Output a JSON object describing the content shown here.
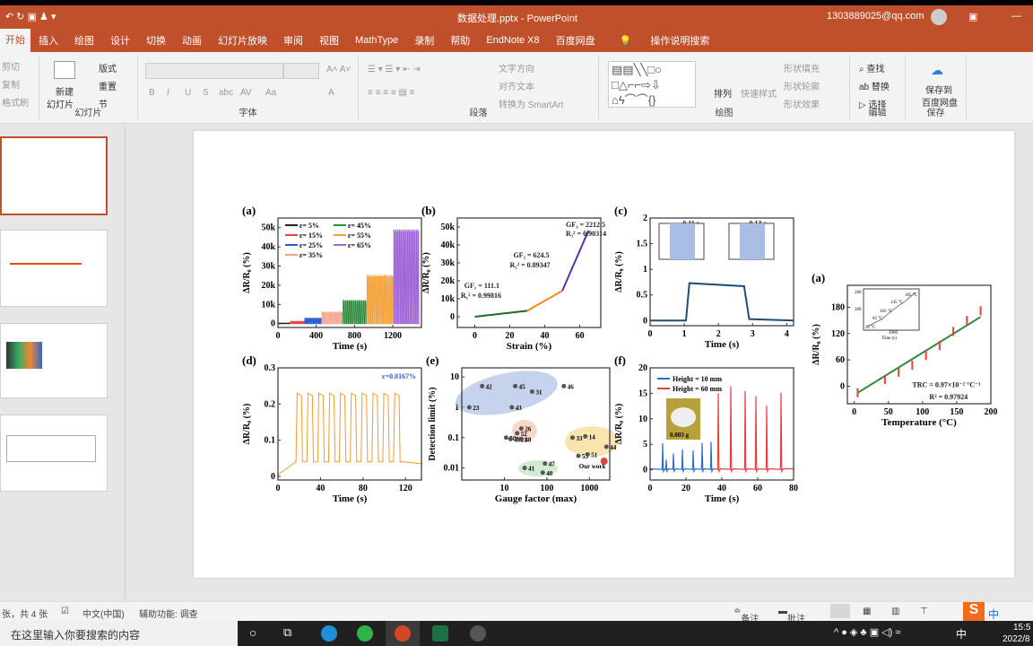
{
  "titlebar": {
    "filename": "数据处理.pptx - PowerPoint",
    "account": "1303889025@qq.com"
  },
  "tabs": [
    "开始",
    "插入",
    "绘图",
    "设计",
    "切换",
    "动画",
    "幻灯片放映",
    "审阅",
    "视图",
    "MathType",
    "录制",
    "帮助",
    "EndNote X8",
    "百度网盘",
    "操作说明搜索"
  ],
  "ribbon": {
    "clipboard": {
      "cut": "剪切",
      "copy": "复制",
      "format_painter": "格式刷"
    },
    "slides": {
      "new_slide": "新建",
      "new_slide2": "幻灯片",
      "layout": "版式",
      "reset": "重置",
      "section": "节",
      "label": "幻灯片"
    },
    "font": {
      "label": "字体",
      "bold": "B",
      "italic": "I",
      "underline": "U",
      "shadow": "S",
      "strike": "abc",
      "spacing": "AV",
      "case": "Aa",
      "color": "A"
    },
    "paragraph": {
      "label": "段落",
      "text_direction": "文字方向",
      "align_text": "对齐文本",
      "smartart": "转换为 SmartArt"
    },
    "drawing": {
      "label": "绘图",
      "arrange": "排列",
      "quick_styles": "快速样式",
      "fill": "形状填充",
      "outline": "形状轮廓",
      "effects": "形状效果"
    },
    "editing": {
      "label": "编辑",
      "find": "查找",
      "replace": "替换",
      "select": "选择"
    },
    "save": {
      "label": "保存",
      "save_to": "保存到",
      "baidu": "百度网盘"
    }
  },
  "status": {
    "slide_count": "张，共 4 张",
    "language": "中文(中国)",
    "accessibility": "辅助功能: 调查",
    "notes": "备注",
    "comments": "批注"
  },
  "taskbar": {
    "search_placeholder": "在这里输入你要搜索的内容",
    "time": "15:5",
    "date": "2022/8",
    "ime": "中"
  },
  "chart_data": [
    {
      "panel": "(a)",
      "type": "line",
      "xlim": [
        0,
        1500
      ],
      "ylim": [
        -2000,
        55000
      ],
      "xlabel": "Time (s)",
      "ylabel": "ΔR/R₀ (%)",
      "xticks": [
        [
          0,
          "0"
        ],
        [
          400,
          "400"
        ],
        [
          800,
          "800"
        ],
        [
          1200,
          "1200"
        ]
      ],
      "yticks": [
        [
          0,
          "0"
        ],
        [
          10000,
          "10k"
        ],
        [
          20000,
          "20k"
        ],
        [
          30000,
          "30k"
        ],
        [
          40000,
          "40k"
        ],
        [
          50000,
          "50k"
        ]
      ],
      "waves": [
        {
          "name": "ε= 5%",
          "color": "#222222",
          "t": [
            0,
            130
          ],
          "peak": 300,
          "cycles": 8
        },
        {
          "name": "ε= 15%",
          "color": "#e8413c",
          "t": [
            130,
            280
          ],
          "peak": 1200,
          "cycles": 8
        },
        {
          "name": "ε= 25%",
          "color": "#2a5bd7",
          "t": [
            280,
            460
          ],
          "peak": 2800,
          "cycles": 10
        },
        {
          "name": "ε= 35%",
          "color": "#f4a088",
          "t": [
            460,
            680
          ],
          "peak": 6000,
          "cycles": 10
        },
        {
          "name": "ε= 45%",
          "color": "#2e8b3e",
          "t": [
            680,
            930
          ],
          "peak": 12000,
          "cycles": 12
        },
        {
          "name": "ε= 55%",
          "color": "#f2a23a",
          "t": [
            930,
            1210
          ],
          "peak": 25000,
          "cycles": 14
        },
        {
          "name": "ε= 65%",
          "color": "#a066d8",
          "t": [
            1210,
            1480
          ],
          "peak": 49000,
          "cycles": 14
        }
      ]
    },
    {
      "panel": "(b)",
      "type": "line",
      "xlim": [
        -10,
        72
      ],
      "ylim": [
        -6000,
        55000
      ],
      "xlabel": "Strain (%)",
      "ylabel": "ΔR/R₀ (%)",
      "xticks": [
        [
          0,
          "0"
        ],
        [
          20,
          "20"
        ],
        [
          40,
          "40"
        ],
        [
          60,
          "60"
        ]
      ],
      "yticks": [
        [
          0,
          "0"
        ],
        [
          10000,
          "10k"
        ],
        [
          20000,
          "20k"
        ],
        [
          30000,
          "30k"
        ],
        [
          40000,
          "40k"
        ],
        [
          50000,
          "50k"
        ]
      ],
      "series": [
        {
          "name": "GF1",
          "color": "#1e6b2a",
          "points": [
            [
              0,
              0
            ],
            [
              30,
              3300
            ]
          ]
        },
        {
          "name": "GF2",
          "color": "#f08a1c",
          "points": [
            [
              30,
              3300
            ],
            [
              50,
              14500
            ]
          ]
        },
        {
          "name": "GF3",
          "color": "#5b2fa8",
          "points": [
            [
              50,
              14500
            ],
            [
              65,
              48000
            ]
          ]
        }
      ],
      "annotations": [
        {
          "text": "GF₃ = 2212.5",
          "x": 52,
          "y": 50000
        },
        {
          "text": "R₃² = 0.90314",
          "x": 52,
          "y": 45000
        },
        {
          "text": "GF₂ = 624.5",
          "x": 22,
          "y": 33000
        },
        {
          "text": "R₂² = 0.89347",
          "x": 20,
          "y": 27500
        },
        {
          "text": "GF₁ = 111.1",
          "x": -6,
          "y": 16000
        },
        {
          "text": "R₁² = 0.99816",
          "x": -8,
          "y": 10500
        }
      ]
    },
    {
      "panel": "(c)",
      "type": "line",
      "xlim": [
        0,
        4.2
      ],
      "ylim": [
        -0.1,
        2
      ],
      "xlabel": "Time (s)",
      "ylabel": "ΔR/R₀ (%)",
      "xticks": [
        [
          0,
          "0"
        ],
        [
          1,
          "1"
        ],
        [
          2,
          "2"
        ],
        [
          3,
          "3"
        ],
        [
          4,
          "4"
        ]
      ],
      "yticks": [
        [
          0,
          "0"
        ],
        [
          0.5,
          "0.5"
        ],
        [
          1,
          "1"
        ],
        [
          1.5,
          "1.5"
        ],
        [
          2,
          "2"
        ]
      ],
      "series": [
        {
          "name": "response",
          "color": "#1f4e79",
          "points": [
            [
              0,
              0
            ],
            [
              1.05,
              0
            ],
            [
              1.15,
              0.73
            ],
            [
              2.75,
              0.67
            ],
            [
              2.9,
              0.03
            ],
            [
              4.2,
              0
            ]
          ]
        }
      ],
      "annotations": [
        {
          "text": "0.11 s",
          "x": 0.95,
          "y": 1.85
        },
        {
          "text": "0.13 s",
          "x": 2.9,
          "y": 1.85
        }
      ]
    },
    {
      "panel": "(a)",
      "type": "line",
      "xlim": [
        -10,
        200
      ],
      "ylim": [
        -40,
        230
      ],
      "xlabel": "Temperature (°C)",
      "ylabel": "ΔR/R₀ (%)",
      "xticks": [
        [
          0,
          "0"
        ],
        [
          50,
          "50"
        ],
        [
          100,
          "100"
        ],
        [
          150,
          "150"
        ],
        [
          200,
          "200"
        ]
      ],
      "yticks": [
        [
          0,
          "0"
        ],
        [
          60,
          "60"
        ],
        [
          120,
          "120"
        ],
        [
          180,
          "180"
        ]
      ],
      "series": [
        {
          "name": "fit",
          "color": "#2e8b3e",
          "points": [
            [
              5,
              -15
            ],
            [
              185,
              158
            ]
          ]
        }
      ],
      "errpoints": {
        "color": "#e8413c",
        "points": [
          [
            5,
            -15
          ],
          [
            45,
            15
          ],
          [
            65,
            32
          ],
          [
            85,
            48
          ],
          [
            105,
            70
          ],
          [
            125,
            93
          ],
          [
            145,
            125
          ],
          [
            165,
            150
          ],
          [
            185,
            172
          ]
        ]
      },
      "annotations": [
        {
          "text": "TRC = 0.97×10⁻² °C⁻¹",
          "x": 85,
          "y": -2
        },
        {
          "text": "R² = 0.97924",
          "x": 110,
          "y": -30
        }
      ],
      "inset_labels": [
        "185 °C",
        "145 °C",
        "105 °C",
        "65 °C",
        "25 °C",
        "Time (s)",
        "2000",
        "200",
        "100"
      ]
    },
    {
      "panel": "(d)",
      "type": "line",
      "xlim": [
        0,
        135
      ],
      "ylim": [
        -0.01,
        0.3
      ],
      "xlabel": "Time (s)",
      "ylabel": "ΔR/R₀ (%)",
      "xticks": [
        [
          0,
          "0"
        ],
        [
          40,
          "40"
        ],
        [
          80,
          "80"
        ],
        [
          120,
          "120"
        ]
      ],
      "yticks": [
        [
          0,
          "0"
        ],
        [
          0.1,
          "0.1"
        ],
        [
          0.2,
          "0.2"
        ],
        [
          0.3,
          "0.3"
        ]
      ],
      "waves": [
        {
          "name": "ε=0.0167%",
          "color": "#f29a2e",
          "t": [
            17,
            119
          ],
          "peak": 0.23,
          "base": 0.04,
          "cycles": 10
        }
      ],
      "annotations": [
        {
          "text": "ε=0.0167%",
          "x": 98,
          "y": 0.27
        }
      ]
    },
    {
      "panel": "(e)",
      "type": "scatter",
      "xlog": true,
      "ylog": true,
      "xlim": [
        1,
        3000
      ],
      "ylim": [
        0.004,
        20
      ],
      "xlabel": "Gauge factor (max)",
      "ylabel": "Detection limit (%)",
      "xticks": [
        [
          10,
          "10"
        ],
        [
          100,
          "100"
        ],
        [
          1000,
          "1000"
        ]
      ],
      "yticks": [
        [
          0.01,
          "0.01"
        ],
        [
          0.1,
          "0.1"
        ],
        [
          1,
          "1"
        ],
        [
          10,
          "10"
        ]
      ],
      "points": [
        [
          "42",
          3,
          5
        ],
        [
          "45",
          18,
          5
        ],
        [
          "31",
          45,
          3.3
        ],
        [
          "46",
          250,
          5
        ],
        [
          "23",
          1.5,
          1
        ],
        [
          "43",
          15,
          1
        ],
        [
          "26",
          25,
          0.2
        ],
        [
          "52",
          20,
          0.14
        ],
        [
          "50",
          11,
          0.1
        ],
        [
          "49",
          14,
          0.09
        ],
        [
          "21",
          20,
          0.09
        ],
        [
          "48",
          25,
          0.09
        ],
        [
          "33",
          400,
          0.1
        ],
        [
          "14",
          800,
          0.11
        ],
        [
          "44",
          2500,
          0.05
        ],
        [
          "53",
          550,
          0.025
        ],
        [
          "51",
          900,
          0.028
        ],
        [
          "47",
          90,
          0.014
        ],
        [
          "41",
          30,
          0.01
        ],
        [
          "40",
          80,
          0.007
        ],
        [
          "Our work",
          2212,
          0.0167
        ]
      ]
    },
    {
      "panel": "(f)",
      "type": "line",
      "xlim": [
        0,
        80
      ],
      "ylim": [
        -2,
        20
      ],
      "xlabel": "Time (s)",
      "ylabel": "ΔR/R₀ (%)",
      "xticks": [
        [
          0,
          "0"
        ],
        [
          20,
          "20"
        ],
        [
          40,
          "40"
        ],
        [
          60,
          "60"
        ],
        [
          80,
          "80"
        ]
      ],
      "yticks": [
        [
          0,
          "0"
        ],
        [
          5,
          "5"
        ],
        [
          10,
          "10"
        ],
        [
          15,
          "15"
        ],
        [
          20,
          "20"
        ]
      ],
      "spikes": [
        {
          "name": "Height = 10 mm",
          "color": "#2a6fc9",
          "range": [
            0,
            36
          ],
          "at": [
            7,
            9,
            13,
            18,
            24,
            29,
            34
          ],
          "h": [
            5.2,
            2,
            3.2,
            4,
            3.8,
            5.3,
            5.5
          ]
        },
        {
          "name": "Height = 60 mm",
          "color": "#e8413c",
          "range": [
            36,
            80
          ],
          "at": [
            38,
            45,
            53,
            59,
            65,
            73
          ],
          "h": [
            15,
            16.4,
            15.5,
            14.4,
            12.6,
            15.1
          ]
        }
      ],
      "photo_label": "0.003 g"
    }
  ]
}
